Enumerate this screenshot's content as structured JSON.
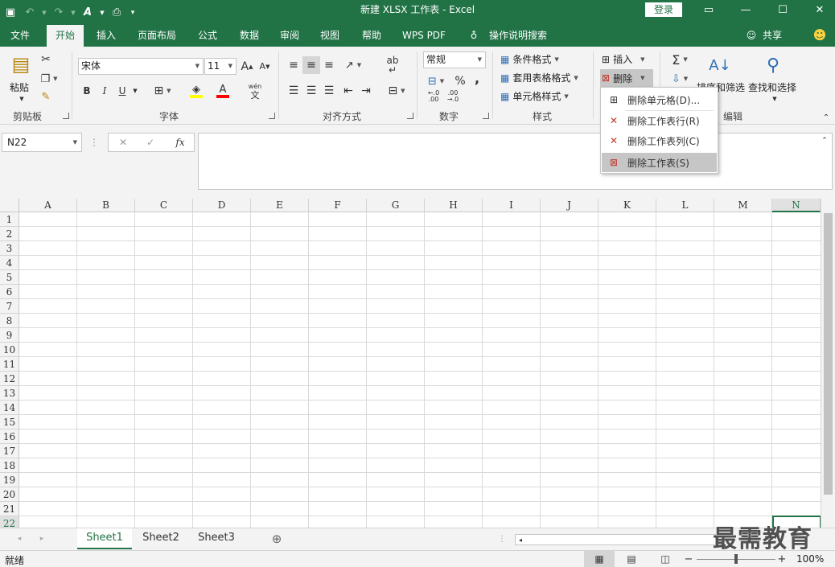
{
  "titlebar": {
    "title": "新建 XLSX 工作表  -  Excel",
    "login": "登录",
    "undo_icon": "undo-icon",
    "redo_icon": "redo-icon"
  },
  "tabs": [
    {
      "label": "文件"
    },
    {
      "label": "开始",
      "active": true
    },
    {
      "label": "插入"
    },
    {
      "label": "页面布局"
    },
    {
      "label": "公式"
    },
    {
      "label": "数据"
    },
    {
      "label": "审阅"
    },
    {
      "label": "视图"
    },
    {
      "label": "帮助"
    },
    {
      "label": "WPS PDF"
    },
    {
      "label": "操作说明搜索"
    }
  ],
  "share": "共享",
  "ribbon": {
    "clipboard": {
      "label": "剪贴板",
      "paste": "粘贴"
    },
    "font": {
      "label": "字体",
      "name": "宋体",
      "size": "11",
      "bold": "B",
      "italic": "I",
      "underline": "U",
      "grow": "A",
      "shrink": "A",
      "fill_color": "#ffff00",
      "font_color": "#ff0000",
      "phonetic_top": "wén",
      "phonetic_bottom": "文",
      "font_letter": "A"
    },
    "alignment": {
      "label": "对齐方式",
      "wrap": "ab"
    },
    "number": {
      "label": "数字",
      "format": "常规",
      "percent": "%",
      "comma": ",",
      "inc_decimal": "←.0\n.00",
      "dec_decimal": ".00\n→.0"
    },
    "styles": {
      "label": "样式",
      "conditional": "条件格式",
      "table": "套用表格格式",
      "cell": "单元格样式"
    },
    "cells": {
      "insert": "插入",
      "delete": "删除"
    },
    "editing": {
      "label": "编辑",
      "sort_filter": "排序和筛选",
      "find_select": "查找和选择",
      "sigma": "Σ"
    }
  },
  "delete_menu": [
    {
      "label": "删除单元格(D)...",
      "icon": "delete-cells-icon",
      "highlighted": false
    },
    {
      "label": "删除工作表行(R)",
      "icon": "delete-row-icon",
      "highlighted": false
    },
    {
      "label": "删除工作表列(C)",
      "icon": "delete-column-icon",
      "highlighted": false
    },
    {
      "label": "删除工作表(S)",
      "icon": "delete-sheet-icon",
      "highlighted": true
    }
  ],
  "formula_bar": {
    "name_box": "N22",
    "fx": "fx",
    "value": ""
  },
  "columns": [
    "A",
    "B",
    "C",
    "D",
    "E",
    "F",
    "G",
    "H",
    "I",
    "J",
    "K",
    "L",
    "M",
    "N"
  ],
  "rows": [
    "1",
    "2",
    "3",
    "4",
    "5",
    "6",
    "7",
    "8",
    "9",
    "10",
    "11",
    "12",
    "13",
    "14",
    "15",
    "16",
    "17",
    "18",
    "19",
    "20",
    "21",
    "22"
  ],
  "selected": {
    "column": "N",
    "row": "22"
  },
  "sheets": [
    {
      "label": "Sheet1",
      "active": true
    },
    {
      "label": "Sheet2",
      "active": false
    },
    {
      "label": "Sheet3",
      "active": false
    }
  ],
  "status": {
    "ready": "就绪",
    "zoom": "100%",
    "zoom_level": 1.0
  },
  "watermark": "最需教育",
  "colors": {
    "brand": "#217346",
    "ribbon_bg": "#f3f3f3",
    "highlight": "#c6c6c6"
  }
}
